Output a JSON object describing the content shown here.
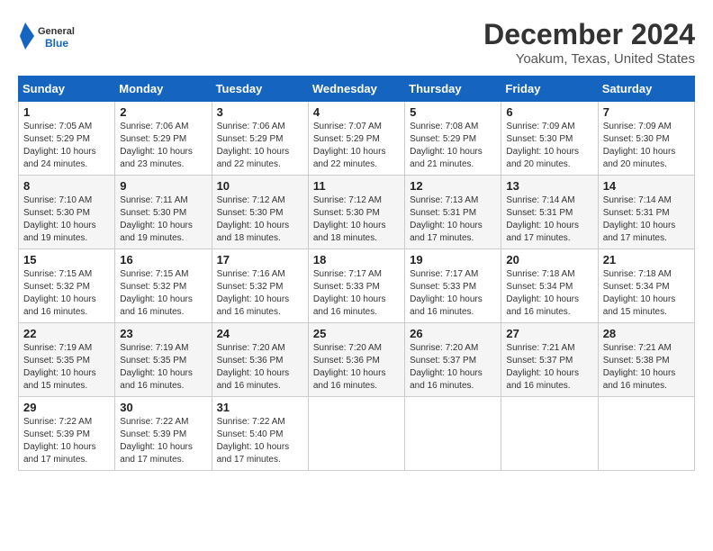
{
  "logo": {
    "general": "General",
    "blue": "Blue"
  },
  "header": {
    "month": "December 2024",
    "location": "Yoakum, Texas, United States"
  },
  "weekdays": [
    "Sunday",
    "Monday",
    "Tuesday",
    "Wednesday",
    "Thursday",
    "Friday",
    "Saturday"
  ],
  "weeks": [
    [
      {
        "day": "1",
        "rise": "7:05 AM",
        "set": "5:29 PM",
        "daylight": "10 hours and 24 minutes."
      },
      {
        "day": "2",
        "rise": "7:06 AM",
        "set": "5:29 PM",
        "daylight": "10 hours and 23 minutes."
      },
      {
        "day": "3",
        "rise": "7:06 AM",
        "set": "5:29 PM",
        "daylight": "10 hours and 22 minutes."
      },
      {
        "day": "4",
        "rise": "7:07 AM",
        "set": "5:29 PM",
        "daylight": "10 hours and 22 minutes."
      },
      {
        "day": "5",
        "rise": "7:08 AM",
        "set": "5:29 PM",
        "daylight": "10 hours and 21 minutes."
      },
      {
        "day": "6",
        "rise": "7:09 AM",
        "set": "5:30 PM",
        "daylight": "10 hours and 20 minutes."
      },
      {
        "day": "7",
        "rise": "7:09 AM",
        "set": "5:30 PM",
        "daylight": "10 hours and 20 minutes."
      }
    ],
    [
      {
        "day": "8",
        "rise": "7:10 AM",
        "set": "5:30 PM",
        "daylight": "10 hours and 19 minutes."
      },
      {
        "day": "9",
        "rise": "7:11 AM",
        "set": "5:30 PM",
        "daylight": "10 hours and 19 minutes."
      },
      {
        "day": "10",
        "rise": "7:12 AM",
        "set": "5:30 PM",
        "daylight": "10 hours and 18 minutes."
      },
      {
        "day": "11",
        "rise": "7:12 AM",
        "set": "5:30 PM",
        "daylight": "10 hours and 18 minutes."
      },
      {
        "day": "12",
        "rise": "7:13 AM",
        "set": "5:31 PM",
        "daylight": "10 hours and 17 minutes."
      },
      {
        "day": "13",
        "rise": "7:14 AM",
        "set": "5:31 PM",
        "daylight": "10 hours and 17 minutes."
      },
      {
        "day": "14",
        "rise": "7:14 AM",
        "set": "5:31 PM",
        "daylight": "10 hours and 17 minutes."
      }
    ],
    [
      {
        "day": "15",
        "rise": "7:15 AM",
        "set": "5:32 PM",
        "daylight": "10 hours and 16 minutes."
      },
      {
        "day": "16",
        "rise": "7:15 AM",
        "set": "5:32 PM",
        "daylight": "10 hours and 16 minutes."
      },
      {
        "day": "17",
        "rise": "7:16 AM",
        "set": "5:32 PM",
        "daylight": "10 hours and 16 minutes."
      },
      {
        "day": "18",
        "rise": "7:17 AM",
        "set": "5:33 PM",
        "daylight": "10 hours and 16 minutes."
      },
      {
        "day": "19",
        "rise": "7:17 AM",
        "set": "5:33 PM",
        "daylight": "10 hours and 16 minutes."
      },
      {
        "day": "20",
        "rise": "7:18 AM",
        "set": "5:34 PM",
        "daylight": "10 hours and 16 minutes."
      },
      {
        "day": "21",
        "rise": "7:18 AM",
        "set": "5:34 PM",
        "daylight": "10 hours and 15 minutes."
      }
    ],
    [
      {
        "day": "22",
        "rise": "7:19 AM",
        "set": "5:35 PM",
        "daylight": "10 hours and 15 minutes."
      },
      {
        "day": "23",
        "rise": "7:19 AM",
        "set": "5:35 PM",
        "daylight": "10 hours and 16 minutes."
      },
      {
        "day": "24",
        "rise": "7:20 AM",
        "set": "5:36 PM",
        "daylight": "10 hours and 16 minutes."
      },
      {
        "day": "25",
        "rise": "7:20 AM",
        "set": "5:36 PM",
        "daylight": "10 hours and 16 minutes."
      },
      {
        "day": "26",
        "rise": "7:20 AM",
        "set": "5:37 PM",
        "daylight": "10 hours and 16 minutes."
      },
      {
        "day": "27",
        "rise": "7:21 AM",
        "set": "5:37 PM",
        "daylight": "10 hours and 16 minutes."
      },
      {
        "day": "28",
        "rise": "7:21 AM",
        "set": "5:38 PM",
        "daylight": "10 hours and 16 minutes."
      }
    ],
    [
      {
        "day": "29",
        "rise": "7:22 AM",
        "set": "5:39 PM",
        "daylight": "10 hours and 17 minutes."
      },
      {
        "day": "30",
        "rise": "7:22 AM",
        "set": "5:39 PM",
        "daylight": "10 hours and 17 minutes."
      },
      {
        "day": "31",
        "rise": "7:22 AM",
        "set": "5:40 PM",
        "daylight": "10 hours and 17 minutes."
      },
      null,
      null,
      null,
      null
    ]
  ],
  "labels": {
    "sunrise": "Sunrise:",
    "sunset": "Sunset:",
    "daylight": "Daylight:"
  }
}
